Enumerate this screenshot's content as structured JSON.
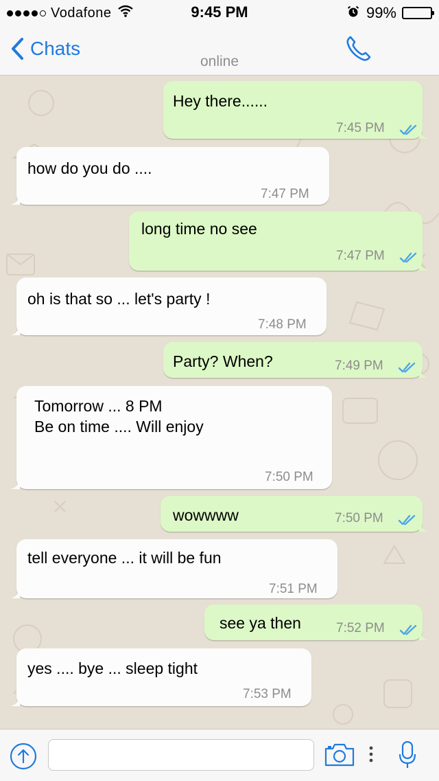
{
  "status_bar": {
    "carrier": "Vodafone",
    "time": "9:45 PM",
    "battery": "99%",
    "battery_level": 0.99
  },
  "nav": {
    "back_label": "Chats",
    "status": "online"
  },
  "messages": [
    {
      "dir": "out",
      "text": "Hey there......",
      "time": "7:45 PM",
      "ticks": "read"
    },
    {
      "dir": "in",
      "text": "how do you do ....",
      "time": "7:47 PM"
    },
    {
      "dir": "out",
      "text": "long time no see",
      "time": "7:47 PM",
      "ticks": "read"
    },
    {
      "dir": "in",
      "text": "oh is that so ... let's party !",
      "time": "7:48 PM"
    },
    {
      "dir": "out",
      "text": "Party? When?",
      "time": "7:49 PM",
      "ticks": "read"
    },
    {
      "dir": "in",
      "text": "Tomorrow ... 8 PM\nBe on time .... Will enjoy",
      "time": "7:50 PM"
    },
    {
      "dir": "out",
      "text": "wowwww",
      "time": "7:50 PM",
      "ticks": "read"
    },
    {
      "dir": "in",
      "text": "tell everyone ... it will be fun",
      "time": "7:51 PM"
    },
    {
      "dir": "out",
      "text": "see ya then",
      "time": "7:52 PM",
      "ticks": "read"
    },
    {
      "dir": "in",
      "text": "yes .... bye ... sleep tight",
      "time": "7:53 PM"
    }
  ],
  "input": {
    "value": "",
    "placeholder": ""
  },
  "colors": {
    "accent": "#1e7ae0",
    "outgoing_bubble": "#dcf8c6",
    "incoming_bubble": "#fcfcfc",
    "chat_background": "#e6dfd3",
    "read_ticks": "#4fa6e6"
  },
  "icons": {
    "back": "chevron-left-icon",
    "call": "phone-icon",
    "upload": "upload-arrow-icon",
    "camera": "camera-icon",
    "more": "more-dots-icon",
    "mic": "microphone-icon",
    "ticks": "double-check-icon"
  }
}
